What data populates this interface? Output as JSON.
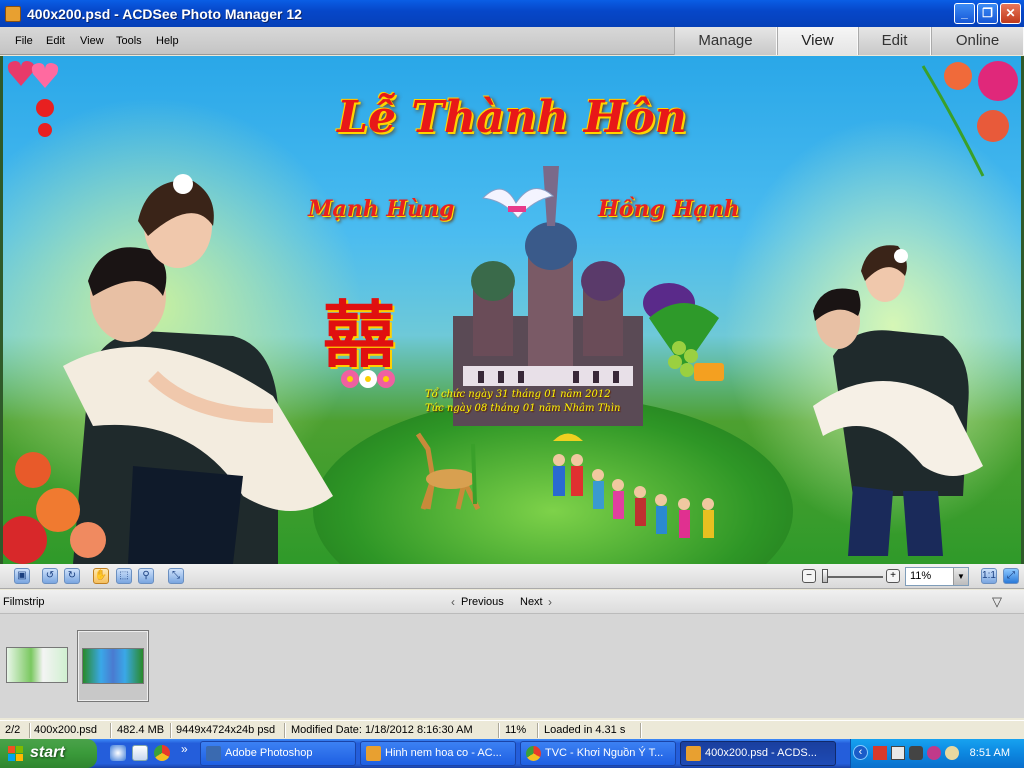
{
  "window": {
    "title": "400x200.psd - ACDSee Photo Manager 12",
    "minimize": "_",
    "maximize": "❐",
    "close": "✕"
  },
  "menu": [
    "File",
    "Edit",
    "View",
    "Tools",
    "Help"
  ],
  "mode_tabs": [
    "Manage",
    "View",
    "Edit",
    "Online"
  ],
  "active_tab": "View",
  "image": {
    "heading": "Lễ Thành Hôn",
    "groom": "Mạnh Hùng",
    "bride": "Hồng Hạnh",
    "date_line1": "Tổ chức ngày 31 tháng 01 năm 2012",
    "date_line2": "Tức ngày 08 tháng 01 năm Nhâm Thìn",
    "double_happiness": "囍"
  },
  "zoom": {
    "value": "11%",
    "minus": "−",
    "plus": "+"
  },
  "filmstrip": {
    "label": "Filmstrip",
    "previous": "Previous",
    "next": "Next",
    "prev_glyph": "‹",
    "next_glyph": "›",
    "collapse_glyph": "▽"
  },
  "status": {
    "position": "2/2",
    "filename": "400x200.psd",
    "size": "482.4 MB",
    "dimensions": "9449x4724x24b psd",
    "modified": "Modified Date: 1/18/2012 8:16:30 AM",
    "zoom": "11%",
    "loaded": "Loaded in 4.31 s"
  },
  "taskbar": {
    "start": "start",
    "more": "»",
    "tasks": [
      "Adobe Photoshop",
      "Hinh nem hoa co - AC...",
      "TVC - Khơi Nguồn Ý T...",
      "400x200.psd - ACDS..."
    ],
    "tray_arrow": "‹",
    "clock": "8:51 AM"
  },
  "colors": {
    "xp_blue": "#245edb",
    "title_red": "#e81818",
    "title_gold": "#ffd400"
  }
}
